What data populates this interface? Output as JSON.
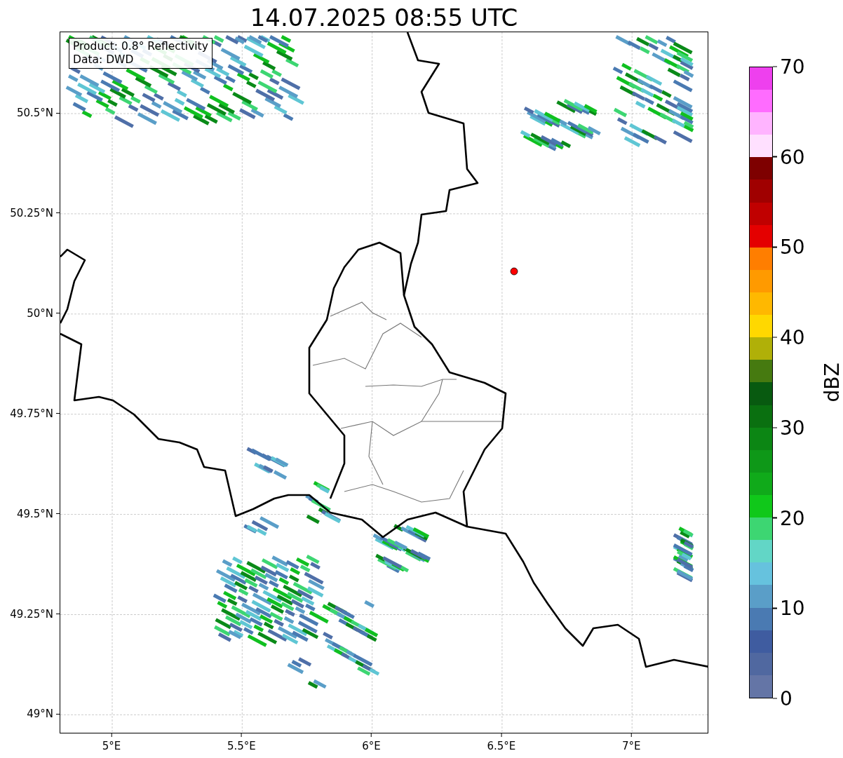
{
  "title": "14.07.2025 08:55 UTC",
  "info_box": [
    "Product: 0.8° Reflectivity",
    "Data: DWD"
  ],
  "map": {
    "x_ticks": [
      "5°E",
      "5.5°E",
      "6°E",
      "6.5°E",
      "7°E"
    ],
    "y_ticks": [
      "50.5°N",
      "50.25°N",
      "50°N",
      "49.75°N",
      "49.5°N",
      "49.25°N",
      "49°N"
    ]
  },
  "colorbar": {
    "label": "dBZ",
    "ticks": [
      "70",
      "60",
      "50",
      "40",
      "30",
      "20",
      "10",
      "0"
    ],
    "segments": [
      {
        "color": "#6475a6"
      },
      {
        "color": "#5068a0"
      },
      {
        "color": "#3f5ca0"
      },
      {
        "color": "#4a7ab2"
      },
      {
        "color": "#5a9ec8"
      },
      {
        "color": "#66c2de"
      },
      {
        "color": "#62d6c6"
      },
      {
        "color": "#3dd672"
      },
      {
        "color": "#10c81a"
      },
      {
        "color": "#10aa1a"
      },
      {
        "color": "#0e9818"
      },
      {
        "color": "#0c8614"
      },
      {
        "color": "#0a7010"
      },
      {
        "color": "#085a10"
      },
      {
        "color": "#467a10"
      },
      {
        "color": "#b0b008"
      },
      {
        "color": "#ffd800"
      },
      {
        "color": "#ffb800"
      },
      {
        "color": "#ff9a00"
      },
      {
        "color": "#ff7e00"
      },
      {
        "color": "#e40000"
      },
      {
        "color": "#c00000"
      },
      {
        "color": "#a00000"
      },
      {
        "color": "#7e0000"
      },
      {
        "color": "#ffe0ff"
      },
      {
        "color": "#ffb4ff"
      },
      {
        "color": "#ff6cff"
      },
      {
        "color": "#ee40ee"
      }
    ]
  }
}
